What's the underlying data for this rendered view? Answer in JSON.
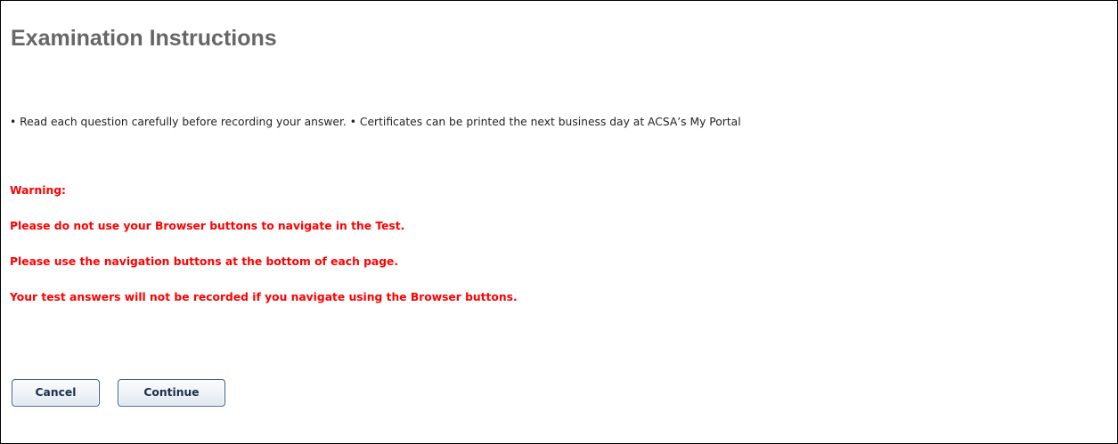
{
  "page": {
    "title": "Examination Instructions",
    "instructions": "• Read each question carefully before recording your answer. • Certificates can be printed the next business day at ACSA’s My Portal"
  },
  "warning": {
    "heading": "Warning:",
    "lines": [
      "Please do not use your Browser buttons to navigate in the Test.",
      "Please use the navigation buttons at the bottom of each page.",
      "Your test answers will not be recorded if you navigate using the Browser buttons."
    ],
    "color": "#ff0000"
  },
  "buttons": {
    "cancel_label": "Cancel",
    "continue_label": "Continue"
  },
  "colors": {
    "title": "#666666",
    "button_border": "#3f5f86"
  }
}
